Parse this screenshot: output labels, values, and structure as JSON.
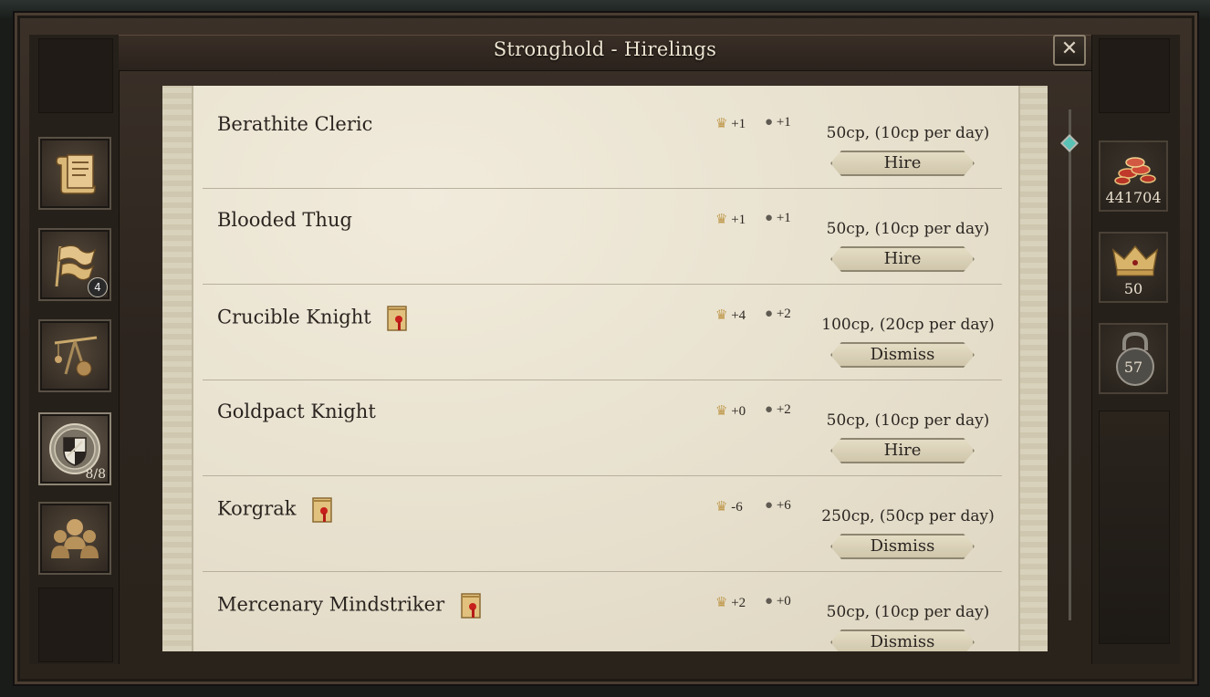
{
  "window": {
    "title": "Stronghold - Hirelings",
    "close_label": "✕"
  },
  "nav": {
    "party_count": "8/8",
    "banner_badge": "4"
  },
  "resources": {
    "copper": "441704",
    "prestige": "50",
    "security": "57"
  },
  "hirelings": [
    {
      "name": "Berathite Cleric",
      "prestige": "+1",
      "security": "+1",
      "cost": "50cp, (10cp per day)",
      "action": "Hire",
      "hired": false
    },
    {
      "name": "Blooded Thug",
      "prestige": "+1",
      "security": "+1",
      "cost": "50cp, (10cp per day)",
      "action": "Hire",
      "hired": false
    },
    {
      "name": "Crucible Knight",
      "prestige": "+4",
      "security": "+2",
      "cost": "100cp, (20cp per day)",
      "action": "Dismiss",
      "hired": true
    },
    {
      "name": "Goldpact Knight",
      "prestige": "+0",
      "security": "+2",
      "cost": "50cp, (10cp per day)",
      "action": "Hire",
      "hired": false
    },
    {
      "name": "Korgrak",
      "prestige": "-6",
      "security": "+6",
      "cost": "250cp, (50cp per day)",
      "action": "Dismiss",
      "hired": true
    },
    {
      "name": "Mercenary Mindstriker",
      "prestige": "+2",
      "security": "+0",
      "cost": "50cp, (10cp per day)",
      "action": "Dismiss",
      "hired": true
    }
  ],
  "colors": {
    "accent": "#59c2b6",
    "parchment": "#ebe4d2",
    "frame": "#2c241e"
  }
}
